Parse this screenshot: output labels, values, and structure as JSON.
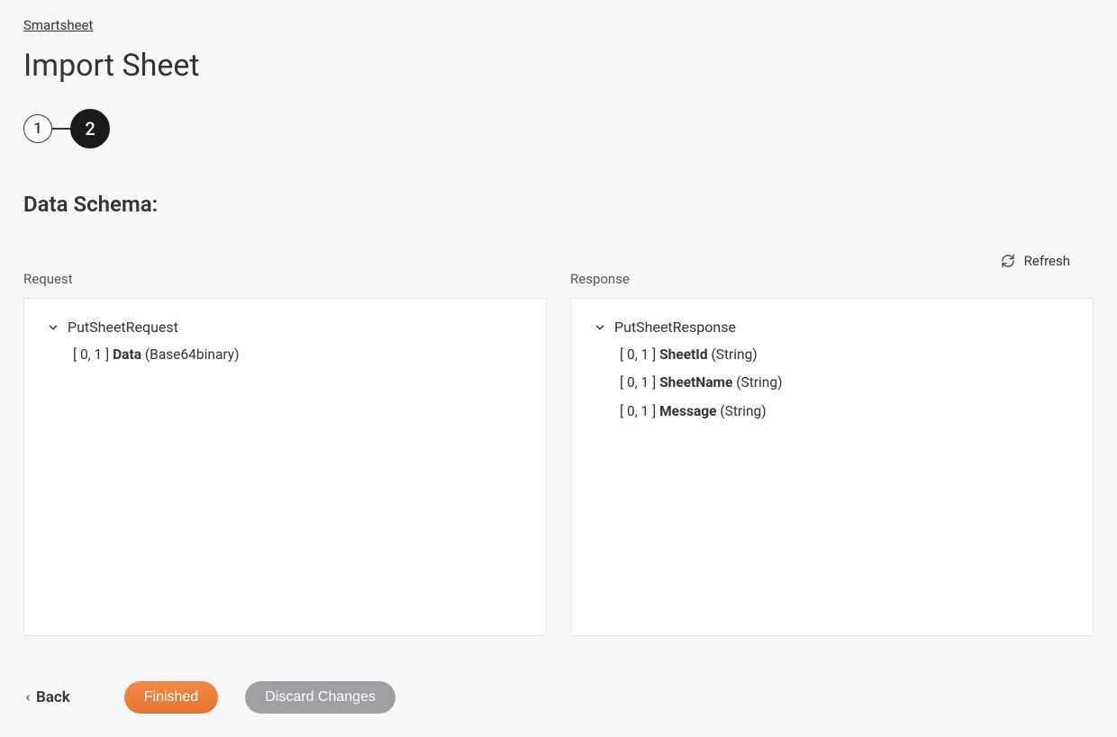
{
  "breadcrumb": "Smartsheet",
  "page_title": "Import Sheet",
  "stepper": {
    "step1": "1",
    "step2": "2"
  },
  "section_heading": "Data Schema:",
  "refresh_label": "Refresh",
  "request": {
    "label": "Request",
    "root": "PutSheetRequest",
    "fields": [
      {
        "card": "[ 0, 1 ]",
        "name": "Data",
        "type": "(Base64binary)"
      }
    ]
  },
  "response": {
    "label": "Response",
    "root": "PutSheetResponse",
    "fields": [
      {
        "card": "[ 0, 1 ]",
        "name": "SheetId",
        "type": "(String)"
      },
      {
        "card": "[ 0, 1 ]",
        "name": "SheetName",
        "type": "(String)"
      },
      {
        "card": "[ 0, 1 ]",
        "name": "Message",
        "type": "(String)"
      }
    ]
  },
  "footer": {
    "back": "Back",
    "finished": "Finished",
    "discard": "Discard Changes"
  }
}
